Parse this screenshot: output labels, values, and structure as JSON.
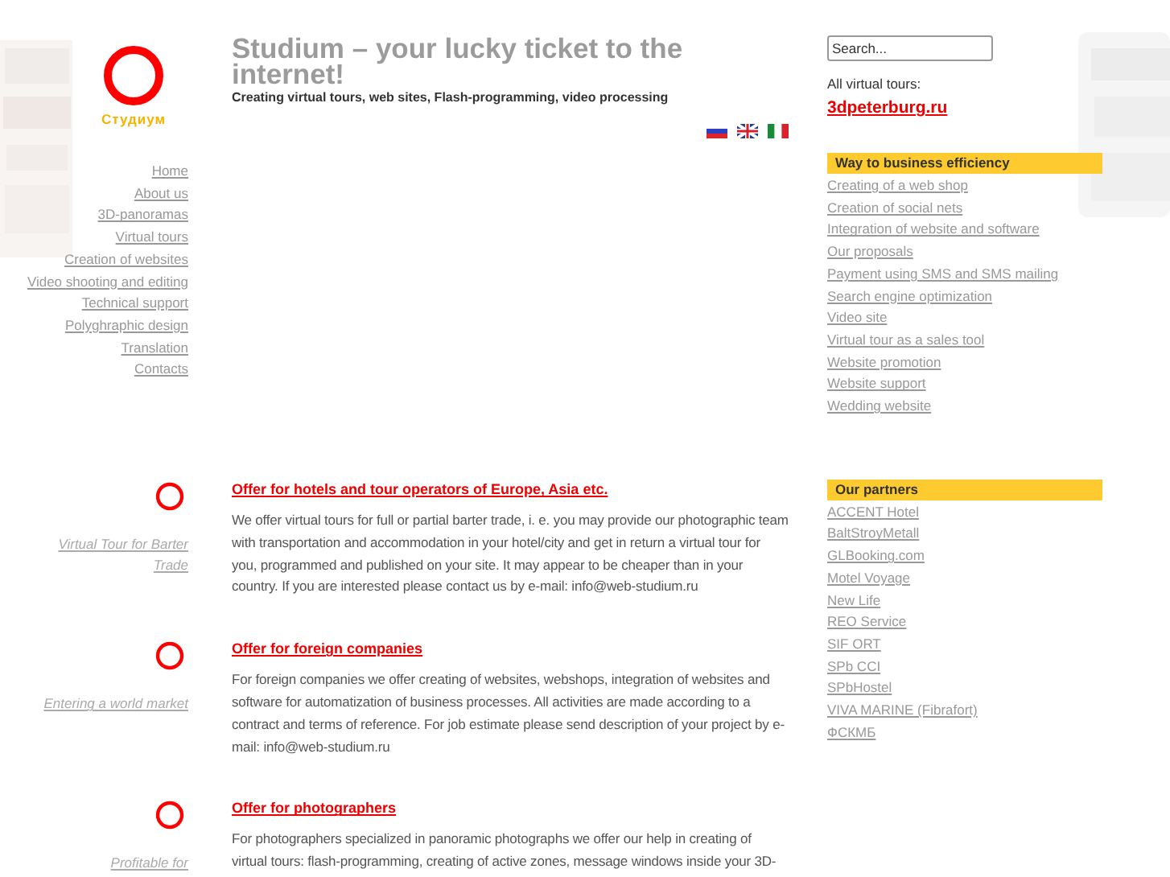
{
  "logo": {
    "caption": "Студиум"
  },
  "header": {
    "title": "Studium – your lucky ticket to the internet!",
    "subtitle": "Creating virtual tours, web sites, Flash-programming, video processing"
  },
  "languages": [
    {
      "kind": "ru"
    },
    {
      "kind": "en"
    },
    {
      "kind": "it"
    }
  ],
  "nav": [
    "Home",
    "About us",
    "3D-panoramas",
    "Virtual tours",
    "Creation of websites",
    "Video shooting and editing",
    "Technical support",
    "Polyghraphic design",
    "Translation",
    "Contacts"
  ],
  "offers": [
    {
      "caption": "Virtual Tour for Barter Trade",
      "title": "Offer for hotels and tour operators of Europe, Asia etc.",
      "text": "We offer virtual tours for full or partial barter trade, i. e. you may provide our photographic team with transportation and accommodation in your hotel/city and get in return a virtual tour for you, programmed and published on your site. It may appear to be cheaper than in your country. If you are interested please contact us by e-mail: info@web-studium.ru"
    },
    {
      "caption": "Entering a world market",
      "title": "Offer for foreign companies",
      "text": "For foreign companies we offer creating of websites, webshops, integration of websites and software for automatization of business processes. All activities are made according to a contract and terms of reference. For job estimate please send description of your project by e-mail: info@web-studium.ru"
    },
    {
      "caption": "Profitable for",
      "title": "Offer for photographers",
      "text": "For photographers specialized in panoramic photographs we offer our help in creating of virtual tours: flash-programming, creating of active zones, message windows inside your 3D-"
    }
  ],
  "sidebar": {
    "search": {
      "placeholder": "Search..."
    },
    "tours_label": "All virtual tours:",
    "tours_link": "3dpeterburg.ru",
    "boxes": [
      {
        "title": "Way to business efficiency",
        "links": [
          "Creating of a web shop",
          "Creation of social nets",
          "Integration of website and software",
          "Our proposals",
          "Payment using SMS and SMS mailing",
          "Search engine optimization",
          "Video site",
          "Virtual tour as a sales tool",
          "Website promotion",
          "Website support",
          "Wedding website"
        ]
      },
      {
        "title": "Our partners",
        "links": [
          "ACCENT Hotel",
          "BaltStroyMetall",
          "GLBooking.com",
          "Motel Voyage",
          "New Life",
          "REO Service",
          "SIF ORT",
          "SPb CCI",
          "SPbHostel",
          "VIVA MARINE (Fibrafort)",
          "ФСКМБ"
        ]
      }
    ]
  }
}
